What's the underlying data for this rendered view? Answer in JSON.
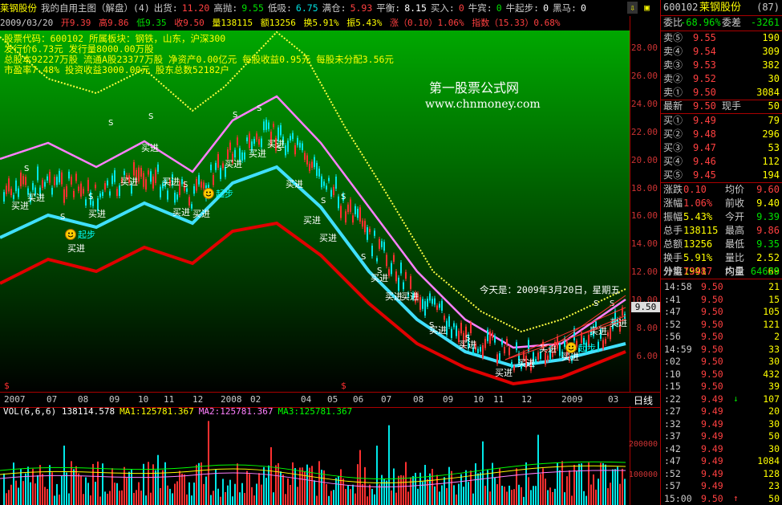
{
  "header": {
    "stock_name": "莱钢股份",
    "title_tabs": [
      "我的自用主图（解盘）(4)"
    ],
    "items": [
      {
        "label": "出货",
        "value": "11.20",
        "color": "#ff4040"
      },
      {
        "label": "高抛",
        "value": "9.55",
        "color": "#00e000"
      },
      {
        "label": "低吸",
        "value": "6.75",
        "color": "#00e0e0"
      },
      {
        "label": "满仓",
        "value": "5.93",
        "color": "#ff4040"
      },
      {
        "label": "平衡",
        "value": "8.15",
        "color": "#ffffff"
      },
      {
        "label": "买入",
        "value": "0",
        "color": "#ff4040"
      },
      {
        "label": "牛宾",
        "value": "0",
        "color": "#00e000"
      },
      {
        "label": "牛起步",
        "value": "0",
        "color": "#ffffff"
      },
      {
        "label": "黑马",
        "value": "0",
        "color": "#ffffff"
      }
    ],
    "icons": {
      "scroll_down": "⇩",
      "lock": "▣"
    }
  },
  "quote_line": {
    "date": "2009/03/20",
    "open": "开9.39",
    "high": "高9.86",
    "low": "低9.35",
    "close": "收9.50",
    "volume": "量138115",
    "amount": "额13256",
    "turnover": "换5.91%",
    "amplitude": "振5.43%",
    "change": "涨（0.10）1.06%",
    "index": "指数（15.33）0.68%"
  },
  "stock_info": {
    "code": "股票代码：600102  所属板块：钢铁，山东，沪深300",
    "issue": "发行价6.73元  发行量8000.00万股",
    "capital": "总股本92227万股  流通A股23377万股  净资产0.00亿元  每股收益0.95元  每股未分配3.56元",
    "ratio": "市盈率7.48%  投资收益3000.00元  股东总数52182户"
  },
  "watermark": {
    "title": "第一股票公式网",
    "url": "www.chnmoney.com"
  },
  "today_note": "今天是：2009年3月20日，星期五",
  "price_axis": {
    "ticks": [
      "28.00",
      "26.00",
      "24.00",
      "22.00",
      "20.00",
      "18.00",
      "16.00",
      "14.00",
      "12.00",
      "10.00",
      "8.00",
      "6.00"
    ],
    "current": "9.50"
  },
  "x_axis": {
    "labels": [
      "2007",
      "07",
      "08",
      "09",
      "10",
      "11",
      "12",
      "2008",
      "02",
      "04",
      "05",
      "06",
      "07",
      "08",
      "09",
      "10",
      "11",
      "12",
      "2009",
      "03"
    ],
    "period": "日线"
  },
  "volume": {
    "legend": [
      {
        "text": "VOL(6,6,6) 138114.578",
        "color": "#ffffff"
      },
      {
        "text": "MA1:125781.367",
        "color": "#ffff00"
      },
      {
        "text": "MA2:125781.367",
        "color": "#ff80ff"
      },
      {
        "text": "MA3:125781.367",
        "color": "#00ff00"
      }
    ],
    "ticks": [
      "200000",
      "100000"
    ]
  },
  "signals": {
    "buy": "买进",
    "rise": "起步",
    "sell_mark": "S"
  },
  "panel": {
    "code": "600102",
    "name": "莱钢股份",
    "count": "(87)",
    "weibi": {
      "label": "委比",
      "value": "-68.96%"
    },
    "weicha": {
      "label": "委差",
      "value": "-3261"
    },
    "sells": [
      {
        "label": "卖⑤",
        "price": "9.55",
        "vol": "190"
      },
      {
        "label": "卖④",
        "price": "9.54",
        "vol": "309"
      },
      {
        "label": "卖③",
        "price": "9.53",
        "vol": "382"
      },
      {
        "label": "卖②",
        "price": "9.52",
        "vol": "30"
      },
      {
        "label": "卖①",
        "price": "9.50",
        "vol": "3084"
      }
    ],
    "latest": {
      "label": "最新",
      "price": "9.50",
      "label2": "现手",
      "vol": "50"
    },
    "buys": [
      {
        "label": "买①",
        "price": "9.49",
        "vol": "79"
      },
      {
        "label": "买②",
        "price": "9.48",
        "vol": "296"
      },
      {
        "label": "买③",
        "price": "9.47",
        "vol": "53"
      },
      {
        "label": "买④",
        "price": "9.46",
        "vol": "112"
      },
      {
        "label": "买⑤",
        "price": "9.45",
        "vol": "194"
      }
    ],
    "stats": [
      {
        "l1": "涨跌",
        "v1": "0.10",
        "c1": "red",
        "l2": "均价",
        "v2": "9.60",
        "c2": "red"
      },
      {
        "l1": "涨幅",
        "v1": "1.06%",
        "c1": "red",
        "l2": "前收",
        "v2": "9.40",
        "c2": "yel"
      },
      {
        "l1": "振幅",
        "v1": "5.43%",
        "c1": "yel",
        "l2": "今开",
        "v2": "9.39",
        "c2": "green"
      },
      {
        "l1": "总手",
        "v1": "138115",
        "c1": "yel",
        "l2": "最高",
        "v2": "9.86",
        "c2": "red"
      },
      {
        "l1": "总额",
        "v1": "13256",
        "c1": "yel",
        "l2": "最低",
        "v2": "9.35",
        "c2": "green"
      },
      {
        "l1": "换手",
        "v1": "5.91%",
        "c1": "yel",
        "l2": "量比",
        "v2": "2.52",
        "c2": "yel"
      },
      {
        "l1": "分笔",
        "v1": "1991",
        "c1": "yel",
        "l2": "均量",
        "v2": "69",
        "c2": "yel"
      }
    ],
    "outer": {
      "label": "外盘",
      "value": "73487"
    },
    "inner": {
      "label": "内盘",
      "value": "64628"
    },
    "ticks": [
      {
        "t": "14:58",
        "p": "9.50",
        "a": "",
        "v": "21"
      },
      {
        "t": ":41",
        "p": "9.50",
        "a": "",
        "v": "15"
      },
      {
        "t": ":47",
        "p": "9.50",
        "a": "",
        "v": "105"
      },
      {
        "t": ":52",
        "p": "9.50",
        "a": "",
        "v": "121"
      },
      {
        "t": ":56",
        "p": "9.50",
        "a": "",
        "v": "2"
      },
      {
        "t": "14:59",
        "p": "9.50",
        "a": "",
        "v": "33"
      },
      {
        "t": ":02",
        "p": "9.50",
        "a": "",
        "v": "30"
      },
      {
        "t": ":10",
        "p": "9.50",
        "a": "",
        "v": "432"
      },
      {
        "t": ":15",
        "p": "9.50",
        "a": "",
        "v": "39"
      },
      {
        "t": ":22",
        "p": "9.49",
        "a": "↓",
        "v": "107"
      },
      {
        "t": ":27",
        "p": "9.49",
        "a": "",
        "v": "20"
      },
      {
        "t": ":32",
        "p": "9.49",
        "a": "",
        "v": "30"
      },
      {
        "t": ":37",
        "p": "9.49",
        "a": "",
        "v": "50"
      },
      {
        "t": ":42",
        "p": "9.49",
        "a": "",
        "v": "30"
      },
      {
        "t": ":47",
        "p": "9.49",
        "a": "",
        "v": "1084"
      },
      {
        "t": ":52",
        "p": "9.49",
        "a": "",
        "v": "128"
      },
      {
        "t": ":57",
        "p": "9.49",
        "a": "",
        "v": "23"
      },
      {
        "t": "15:00",
        "p": "9.50",
        "a": "↑",
        "v": "50"
      }
    ]
  }
}
